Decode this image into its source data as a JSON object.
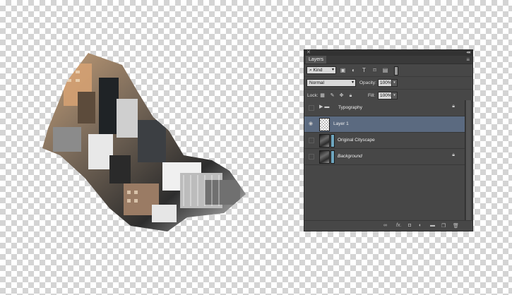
{
  "panel": {
    "close_glyph": "✕",
    "collapse_glyph": "◂◂",
    "tab_label": "Layers",
    "menu_glyph": "≡",
    "filter": {
      "kind_label": "Kind",
      "search_icon": "magnifier-icon"
    },
    "blend_mode": "Normal",
    "opacity_label": "Opacity:",
    "opacity_value": "100%",
    "lock_label": "Lock:",
    "fill_label": "Fill:",
    "fill_value": "100%"
  },
  "layers": [
    {
      "name": "Typography",
      "type": "group",
      "visible": false,
      "locked": true,
      "active": false
    },
    {
      "name": "Layer 1",
      "type": "pixel",
      "visible": true,
      "locked": false,
      "active": true
    },
    {
      "name": "Original Cityscape",
      "type": "pixel",
      "visible": false,
      "locked": false,
      "active": false
    },
    {
      "name": "Background",
      "type": "pixel",
      "visible": false,
      "locked": true,
      "active": false
    }
  ],
  "colors": {
    "panel_bg": "#474747",
    "active_layer": "#5b6a80",
    "checker": "#d4d4d4"
  }
}
